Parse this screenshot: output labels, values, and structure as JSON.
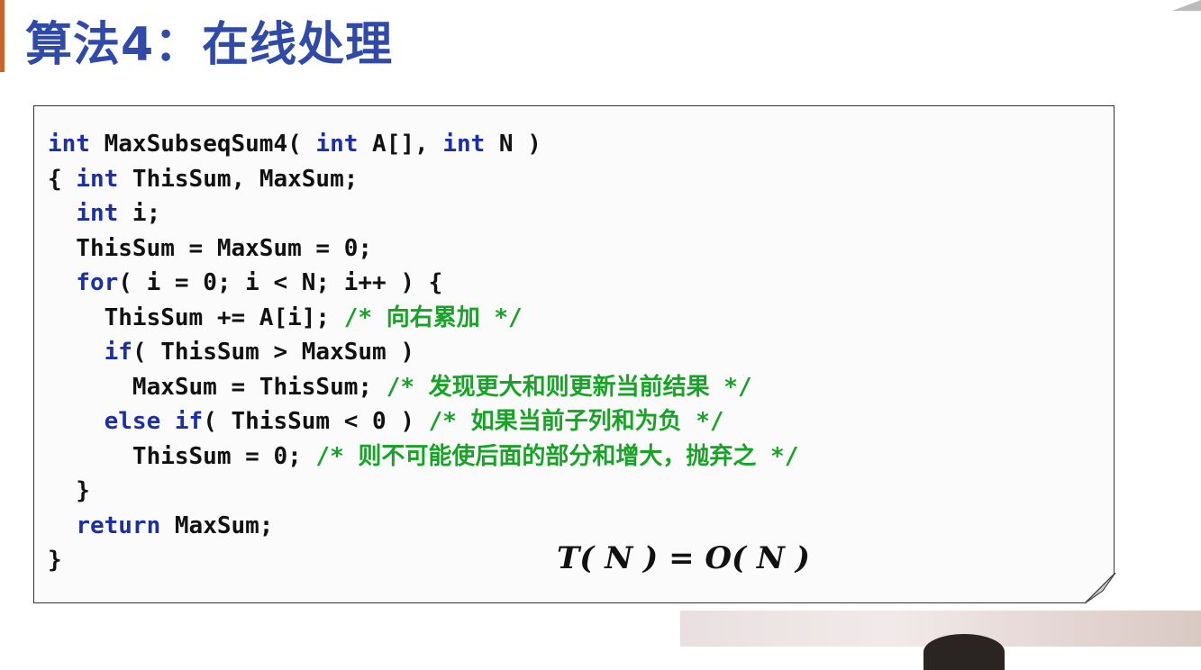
{
  "slide": {
    "title": "算法4：在线处理"
  },
  "code": {
    "lines": [
      [
        {
          "t": "int",
          "c": "kw"
        },
        {
          "t": " MaxSubseqSum4( ",
          "c": ""
        },
        {
          "t": "int",
          "c": "kw"
        },
        {
          "t": " A[], ",
          "c": ""
        },
        {
          "t": "int",
          "c": "kw"
        },
        {
          "t": " N )",
          "c": ""
        }
      ],
      [
        {
          "t": "{ ",
          "c": ""
        },
        {
          "t": "int",
          "c": "kw"
        },
        {
          "t": " ThisSum, MaxSum;",
          "c": ""
        }
      ],
      [
        {
          "t": "  ",
          "c": ""
        },
        {
          "t": "int",
          "c": "kw"
        },
        {
          "t": " i;",
          "c": ""
        }
      ],
      [
        {
          "t": "  ThisSum = MaxSum = 0;",
          "c": ""
        }
      ],
      [
        {
          "t": "  ",
          "c": ""
        },
        {
          "t": "for",
          "c": "kw"
        },
        {
          "t": "( i = 0; i < N; i++ ) {",
          "c": ""
        }
      ],
      [
        {
          "t": "    ThisSum += A[i]; ",
          "c": ""
        },
        {
          "t": "/* 向右累加 */",
          "c": "cm"
        }
      ],
      [
        {
          "t": "    ",
          "c": ""
        },
        {
          "t": "if",
          "c": "kw"
        },
        {
          "t": "( ThisSum > MaxSum )",
          "c": ""
        }
      ],
      [
        {
          "t": "      MaxSum = ThisSum; ",
          "c": ""
        },
        {
          "t": "/* 发现更大和则更新当前结果 */",
          "c": "cm"
        }
      ],
      [
        {
          "t": "    ",
          "c": ""
        },
        {
          "t": "else if",
          "c": "kw"
        },
        {
          "t": "( ThisSum < 0 ) ",
          "c": ""
        },
        {
          "t": "/* 如果当前子列和为负 */",
          "c": "cm"
        }
      ],
      [
        {
          "t": "      ThisSum = 0; ",
          "c": ""
        },
        {
          "t": "/* 则不可能使后面的部分和增大，抛弃之 */",
          "c": "cm"
        }
      ],
      [
        {
          "t": "  }",
          "c": ""
        }
      ],
      [
        {
          "t": "  ",
          "c": ""
        },
        {
          "t": "return",
          "c": "kw"
        },
        {
          "t": " MaxSum;",
          "c": ""
        }
      ],
      [
        {
          "t": "}",
          "c": ""
        }
      ]
    ],
    "complexity": "T( N ) = O( N )"
  },
  "colors": {
    "title": "#2f4aa8",
    "keyword": "#1b2fa6",
    "comment": "#17a325",
    "text": "#111111",
    "accent": "#c8642a"
  }
}
